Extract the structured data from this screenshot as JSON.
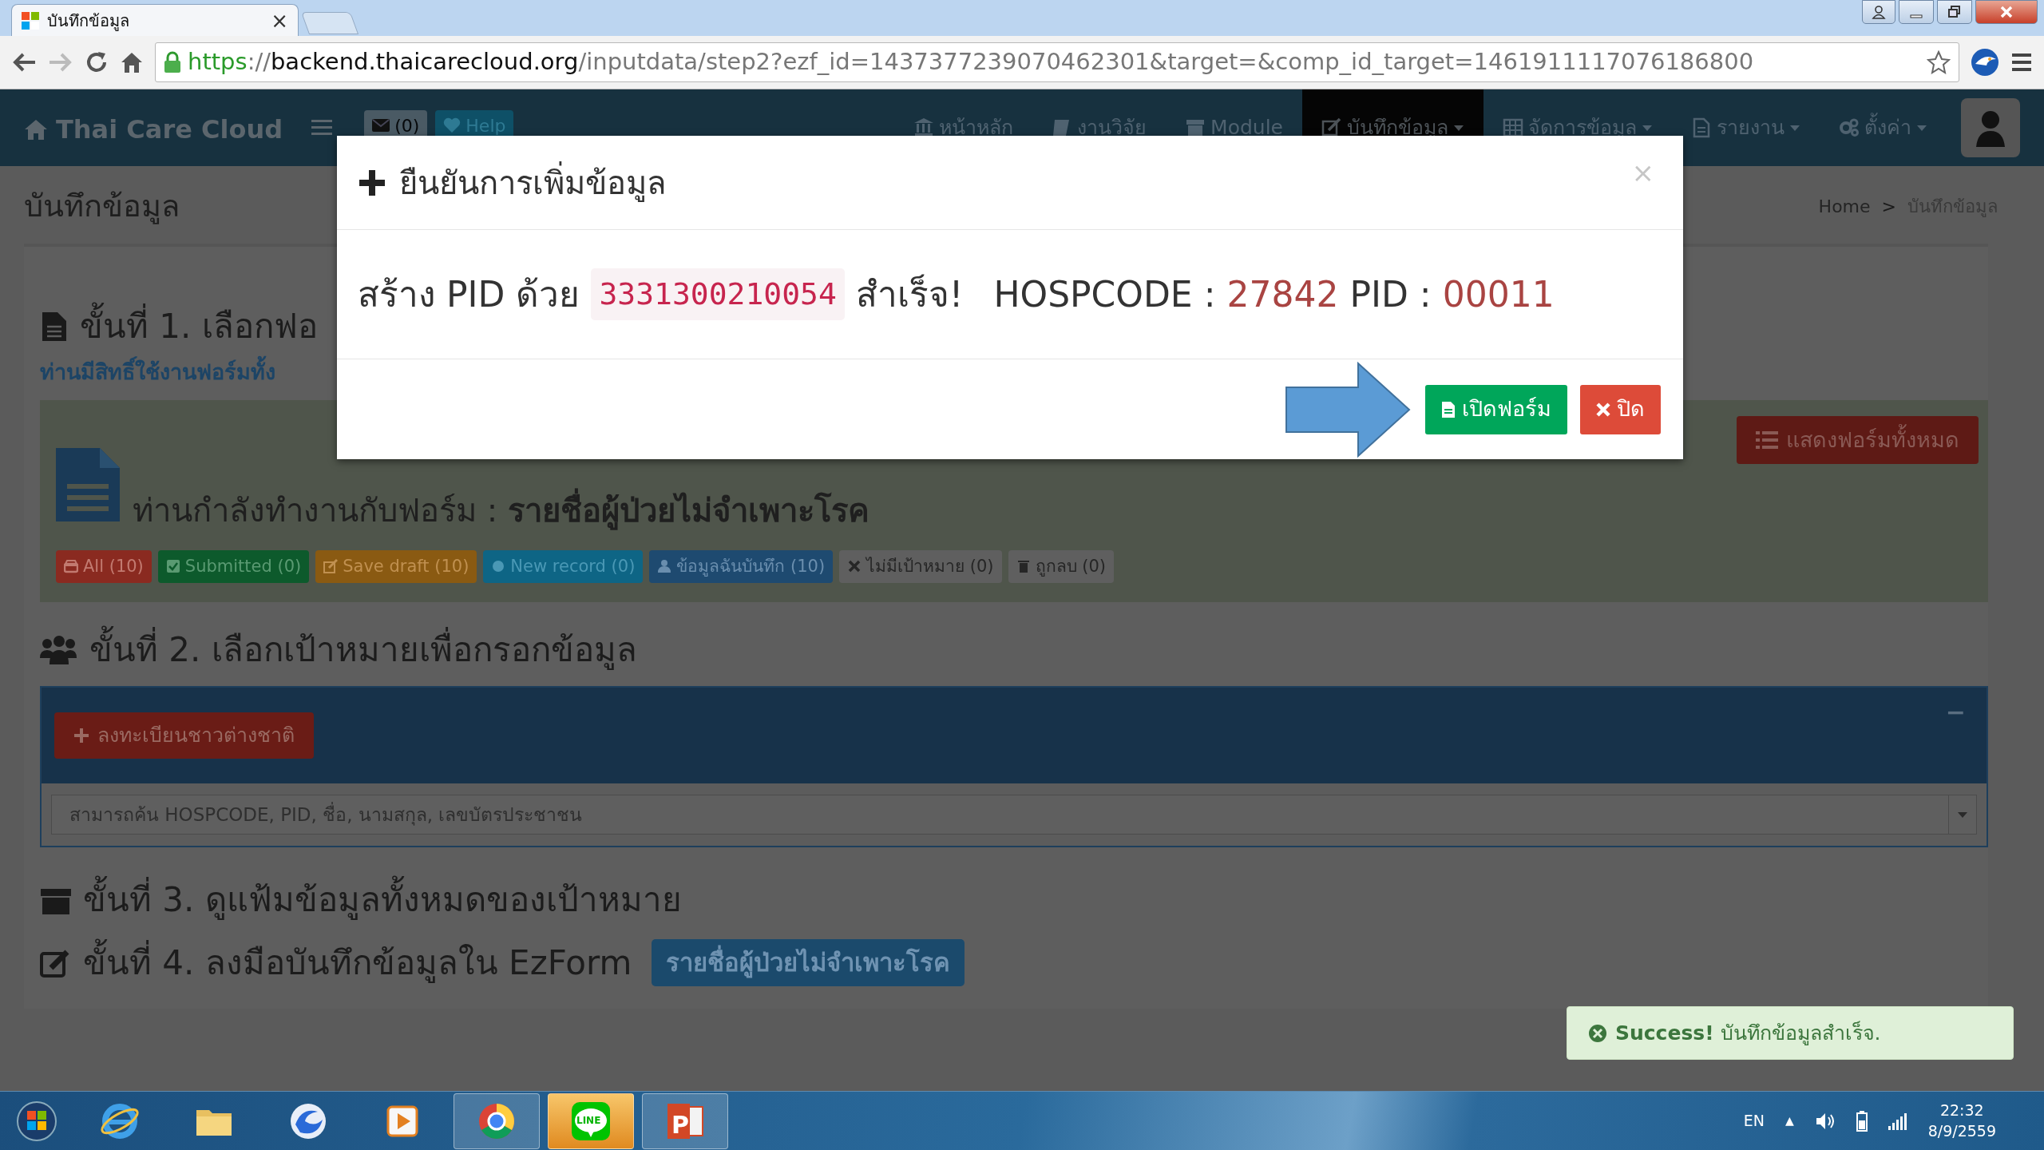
{
  "browser": {
    "tab": {
      "title": "บันทึกข้อมูล",
      "close": "×"
    },
    "url": [
      {
        "text": "https",
        "kind": "secure"
      },
      {
        "text": "://",
        "kind": "dim"
      },
      {
        "text": "backend.thaicarecloud.org",
        "kind": "host"
      },
      {
        "text": "/inputdata/step2?ezf_id=1437377239070462301&target=&comp_id_target=1461911117076186800",
        "kind": "dim"
      }
    ]
  },
  "app_nav": {
    "brand": "Thai Care Cloud",
    "messages": "(0)",
    "help": "Help",
    "items": [
      {
        "label": "หน้าหลัก",
        "selected": false,
        "dropdown": false
      },
      {
        "label": "งานวิจัย",
        "selected": false,
        "dropdown": false
      },
      {
        "label": "Module",
        "selected": false,
        "dropdown": false
      },
      {
        "label": "บันทึกข้อมูล",
        "selected": true,
        "dropdown": true
      },
      {
        "label": "จัดการข้อมูล",
        "selected": false,
        "dropdown": true
      },
      {
        "label": "รายงาน",
        "selected": false,
        "dropdown": true
      },
      {
        "label": "ตั้งค่า",
        "selected": false,
        "dropdown": true
      }
    ]
  },
  "page": {
    "title": "บันทึกข้อมูล",
    "breadcrumb": [
      "Home",
      "บันทึกข้อมูล"
    ],
    "separator": ">"
  },
  "step1": {
    "heading": "ขั้นที่ 1. เลือกฟอ",
    "note": "ท่านมีสิทธิ์ใช้งานฟอร์มทั้ง",
    "form_title": "ท่านกำลังทำงานกับฟอร์ม : **รายชื่อผู้ป่วยไม่จำเพาะโรค**",
    "show_all": "แสดงฟอร์มทั้งหมด",
    "filters": [
      {
        "label": "All (10)",
        "kind": "danger"
      },
      {
        "label": "Submitted (0)",
        "kind": "success"
      },
      {
        "label": "Save draft (10)",
        "kind": "warning"
      },
      {
        "label": "New record (0)",
        "kind": "info"
      },
      {
        "label": "ข้อมูลฉันบันทึก (10)",
        "kind": "primary"
      },
      {
        "label": "ไม่มีเป้าหมาย (0)",
        "kind": "default"
      },
      {
        "label": "ถูกลบ (0)",
        "kind": "default"
      }
    ]
  },
  "step2": {
    "heading": "ขั้นที่ 2. เลือกเป้าหมายเพื่อกรอกข้อมูล",
    "register": "ลงทะเบียนชาวต่างชาติ",
    "collapse": "−",
    "search": {
      "placeholder": "สามารถค้น HOSPCODE, PID, ชื่อ, นามสกุล, เลขบัตรประชาชน"
    }
  },
  "step3": {
    "heading": "ขั้นที่ 3. ดูแฟ้มข้อมูลทั้งหมดของเป้าหมาย"
  },
  "step4": {
    "heading": "ขั้นที่ 4. ลงมือบันทึกข้อมูลใน EzForm",
    "form_link": "รายชื่อผู้ป่วยไม่จำเพาะโรค"
  },
  "modal": {
    "title": "ยืนยันการเพิ่มข้อมูล",
    "close": "×",
    "prefix": "สร้าง PID ด้วย",
    "cid": "3331300210054",
    "suffix": "สำเร็จ!",
    "hospcode_label": "HOSPCODE :",
    "hospcode": "27842",
    "pid_label": "PID :",
    "pid": "00011",
    "buttons": [
      {
        "label": "เปิดฟอร์ม",
        "kind": "success"
      },
      {
        "label": "ปิด",
        "kind": "danger"
      }
    ]
  },
  "toast": {
    "message": "**Success!** บันทึกข้อมูลสำเร็จ."
  },
  "taskbar": {
    "apps": [
      {
        "kind": "orb",
        "open": false,
        "attention": false
      },
      {
        "kind": "globe",
        "open": false,
        "attention": false
      },
      {
        "kind": "folder",
        "open": false,
        "attention": false
      },
      {
        "kind": "swirl",
        "open": false,
        "attention": false
      },
      {
        "kind": "play",
        "open": false,
        "attention": false
      },
      {
        "kind": "ring",
        "open": true,
        "attention": false
      },
      {
        "kind": "chat",
        "glyph": "LINE",
        "open": true,
        "attention": true
      },
      {
        "kind": "slides",
        "glyph": "P",
        "open": true,
        "attention": false
      }
    ],
    "language": "EN",
    "tray_toggle": "▲",
    "time": "22:32",
    "date": "8/9/2559"
  }
}
